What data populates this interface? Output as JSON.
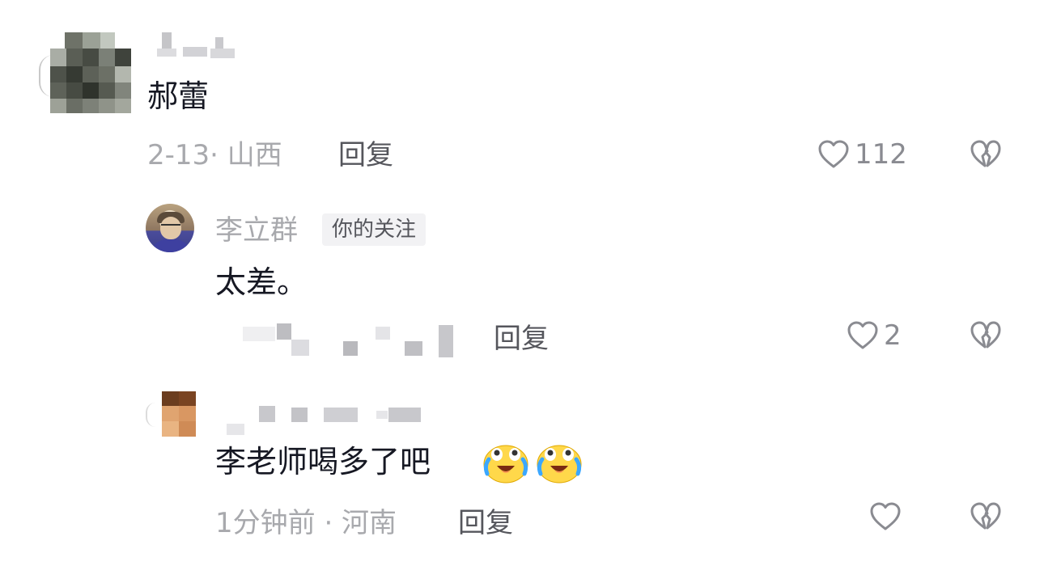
{
  "comments": [
    {
      "text": "郝蕾",
      "date_location": "2-13· 山西",
      "reply_label": "回复",
      "like_count": "112"
    },
    {
      "username": "李立群",
      "follow_badge": "你的关注",
      "text": "太差。",
      "reply_label": "回复",
      "like_count": "2"
    },
    {
      "text": "李老师喝多了吧",
      "date_location": "1分钟前 · 河南",
      "reply_label": "回复",
      "like_count": ""
    }
  ],
  "icons": {
    "like": "heart-outline-icon",
    "dislike": "broken-heart-icon",
    "emoji": "crying-laughing-face-emoji"
  }
}
